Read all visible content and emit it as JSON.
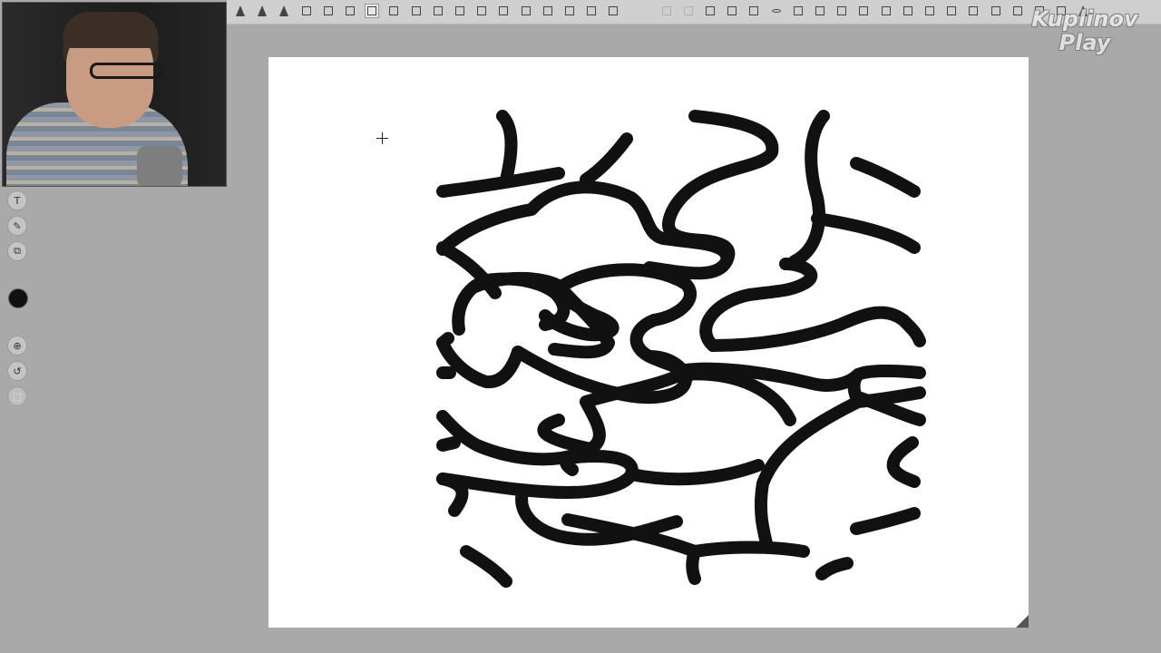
{
  "watermark": {
    "line1": "Kuplinov",
    "line2": "Play"
  },
  "toolbar": {
    "icons": [
      "tree-shape-icon",
      "tree-shape-icon",
      "tree-shape-icon",
      "stamp-icon",
      "stamp-icon",
      "chair-icon",
      "flower-icon",
      "tile-icon",
      "tile-icon",
      "frame-icon",
      "tile-icon",
      "shape-icon",
      "rectangle-icon",
      "tile-icon",
      "tile-icon",
      "ladder-icon",
      "tile-icon",
      "grid-icon",
      "shape-icon",
      "shape-icon",
      "frame-icon",
      "camera-icon",
      "camera-icon",
      "oval-icon",
      "shape-icon",
      "line-icon",
      "plant-icon",
      "plant-icon",
      "lamp-icon",
      "shape-icon",
      "shape-icon",
      "line-icon",
      "shape-icon",
      "shape-icon",
      "line-icon",
      "lamp-icon",
      "shape-icon",
      "tree-shape-icon"
    ]
  },
  "side_tools": {
    "text_tool": "T",
    "fill_tool": "fill-icon",
    "shapes_tool": "shapes-icon",
    "current_color": "#111111",
    "zoom_tool": "zoom-icon",
    "undo_tool": "undo-icon",
    "delete_tool": "trash-icon"
  },
  "canvas": {
    "background": "#ffffff",
    "stroke_color": "#111111"
  }
}
